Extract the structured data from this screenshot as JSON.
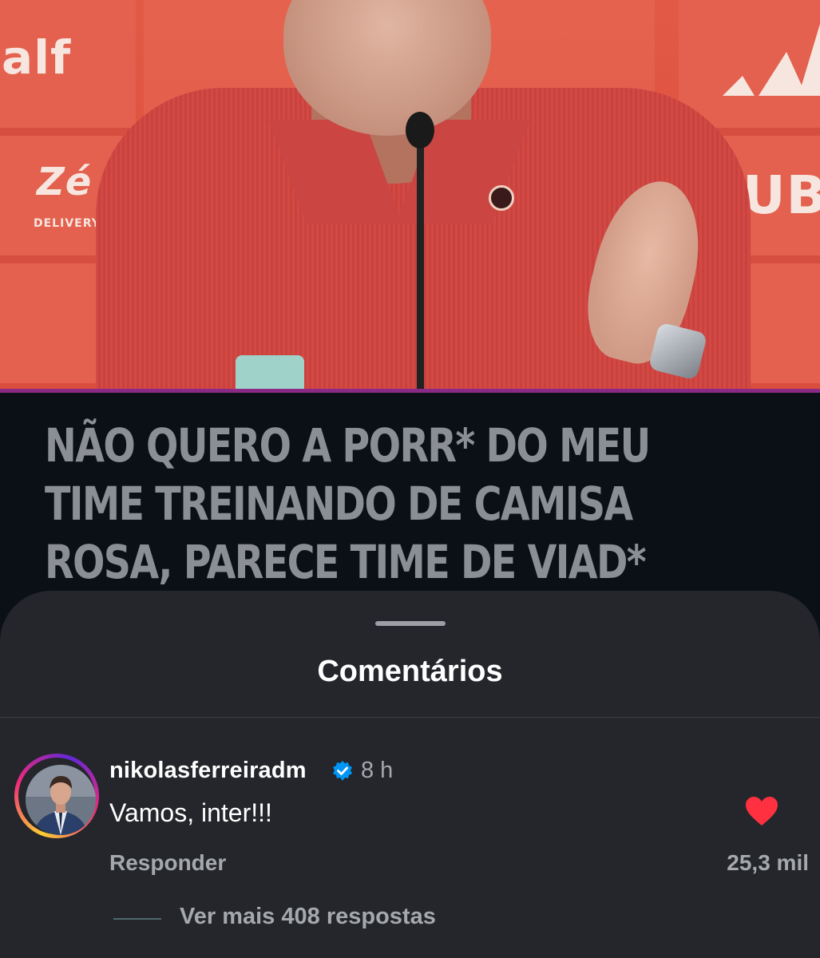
{
  "video": {
    "sponsors": {
      "top_left": "alf",
      "mid_left": "Zé",
      "mid_left_sub": "DELIVERY",
      "mid_right": "UB"
    },
    "caption_lines": [
      "NÃO QUERO A PORR* DO MEU",
      "TIME TREINANDO DE CAMISA",
      "ROSA, PARECE TIME DE VIAD*"
    ],
    "accent_color": "#8a2a86"
  },
  "sheet": {
    "title": "Comentários",
    "comment": {
      "username": "nikolasferreiradm",
      "verified_icon": "verified-badge-icon",
      "time": "8 h",
      "text": "Vamos, inter!!!",
      "reply_label": "Responder",
      "likes": "25,3 mil",
      "liked": true,
      "heart_color": "#ff3040",
      "view_more_replies": "Ver mais 408 respostas"
    }
  }
}
